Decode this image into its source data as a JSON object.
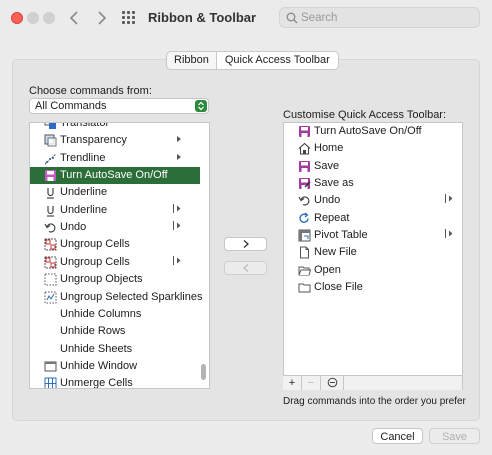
{
  "window": {
    "title": "Ribbon & Toolbar"
  },
  "search": {
    "placeholder": "Search"
  },
  "tabs": [
    {
      "label": "Ribbon",
      "active": false
    },
    {
      "label": "Quick Access Toolbar",
      "active": true
    }
  ],
  "choose": {
    "label": "Choose commands from:",
    "selected": "All Commands"
  },
  "commands": [
    {
      "label": "Translator",
      "icon": "translator-icon"
    },
    {
      "label": "Transparency",
      "icon": "transparency-icon",
      "submenu": "arrow"
    },
    {
      "label": "Trendline",
      "icon": "trendline-icon",
      "submenu": "arrow"
    },
    {
      "label": "Turn AutoSave On/Off",
      "icon": "save-icon",
      "selected": true
    },
    {
      "label": "Underline",
      "icon": "underline-icon"
    },
    {
      "label": "Underline",
      "icon": "underline-icon",
      "submenu": "bar"
    },
    {
      "label": "Undo",
      "icon": "undo-icon",
      "submenu": "bar"
    },
    {
      "label": "Ungroup Cells",
      "icon": "ungroup-cells-icon"
    },
    {
      "label": "Ungroup Cells",
      "icon": "ungroup-cells-icon",
      "submenu": "bar"
    },
    {
      "label": "Ungroup Objects",
      "icon": "ungroup-objects-icon"
    },
    {
      "label": "Ungroup Selected Sparklines",
      "icon": "ungroup-sparklines-icon"
    },
    {
      "label": "Unhide Columns",
      "icon": ""
    },
    {
      "label": "Unhide Rows",
      "icon": ""
    },
    {
      "label": "Unhide Sheets",
      "icon": ""
    },
    {
      "label": "Unhide Window",
      "icon": "window-icon"
    },
    {
      "label": "Unmerge Cells",
      "icon": "unmerge-cells-icon"
    }
  ],
  "customise": {
    "label": "Customise Quick Access Toolbar:"
  },
  "toolbar_items": [
    {
      "label": "Turn AutoSave On/Off",
      "icon": "save-icon"
    },
    {
      "label": "Home",
      "icon": "home-icon"
    },
    {
      "label": "Save",
      "icon": "save-icon"
    },
    {
      "label": "Save as",
      "icon": "save-as-icon"
    },
    {
      "label": "Undo",
      "icon": "undo-icon",
      "submenu": "bar"
    },
    {
      "label": "Repeat",
      "icon": "repeat-icon"
    },
    {
      "label": "Pivot Table",
      "icon": "pivot-table-icon",
      "submenu": "bar"
    },
    {
      "label": "New File",
      "icon": "new-file-icon"
    },
    {
      "label": "Open",
      "icon": "open-folder-icon"
    },
    {
      "label": "Close File",
      "icon": "close-file-icon"
    }
  ],
  "move": {
    "add": ">",
    "remove": "<"
  },
  "toolbar_controls": {
    "add": "+",
    "remove": "−",
    "options": "⊖"
  },
  "hint": "Drag commands into the order you prefer",
  "buttons": {
    "cancel": "Cancel",
    "save": "Save"
  },
  "colors": {
    "accent": "#2c6e3a",
    "popup_step": "#2c8a3e",
    "save_icon": "#a23aa0"
  }
}
